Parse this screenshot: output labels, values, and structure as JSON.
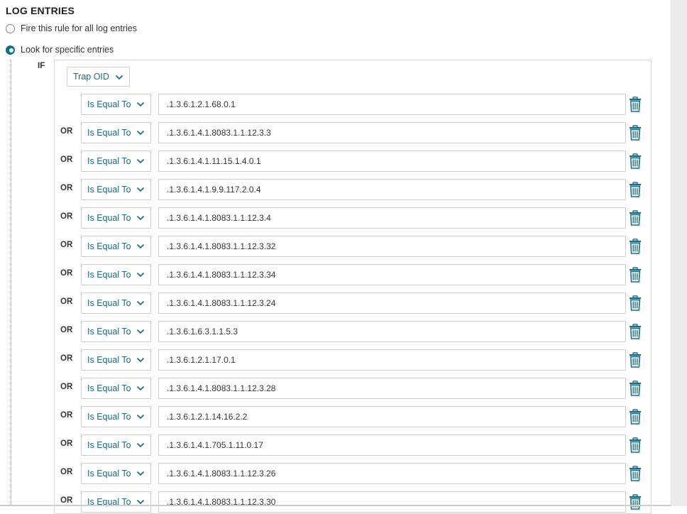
{
  "section": {
    "title": "LOG ENTRIES",
    "options": [
      {
        "label": "Fire this rule for all log entries",
        "selected": false
      },
      {
        "label": "Look for specific entries",
        "selected": true
      }
    ]
  },
  "condition": {
    "if_label": "IF",
    "field_select": "Trap OID",
    "operator_default": "Is Equal To",
    "rows": [
      {
        "connector": "",
        "operator": "Is Equal To",
        "value": ".1.3.6.1.2.1.68.0.1"
      },
      {
        "connector": "OR",
        "operator": "Is Equal To",
        "value": ".1.3.6.1.4.1.8083.1.1.12.3.3"
      },
      {
        "connector": "OR",
        "operator": "Is Equal To",
        "value": ".1.3.6.1.4.1.11.15.1.4.0.1"
      },
      {
        "connector": "OR",
        "operator": "Is Equal To",
        "value": ".1.3.6.1.4.1.9.9.117.2.0.4"
      },
      {
        "connector": "OR",
        "operator": "Is Equal To",
        "value": ".1.3.6.1.4.1.8083.1.1.12.3.4"
      },
      {
        "connector": "OR",
        "operator": "Is Equal To",
        "value": ".1.3.6.1.4.1.8083.1.1.12.3.32"
      },
      {
        "connector": "OR",
        "operator": "Is Equal To",
        "value": ".1.3.6.1.4.1.8083.1.1.12.3.34"
      },
      {
        "connector": "OR",
        "operator": "Is Equal To",
        "value": ".1.3.6.1.4.1.8083.1.1.12.3.24"
      },
      {
        "connector": "OR",
        "operator": "Is Equal To",
        "value": ".1.3.6.1.6.3.1.1.5.3"
      },
      {
        "connector": "OR",
        "operator": "Is Equal To",
        "value": ".1.3.6.1.2.1.17.0.1"
      },
      {
        "connector": "OR",
        "operator": "Is Equal To",
        "value": ".1.3.6.1.4.1.8083.1.1.12.3.28"
      },
      {
        "connector": "OR",
        "operator": "Is Equal To",
        "value": ".1.3.6.1.2.1.14.16.2.2"
      },
      {
        "connector": "OR",
        "operator": "Is Equal To",
        "value": ".1.3.6.1.4.1.705.1.11.0.17"
      },
      {
        "connector": "OR",
        "operator": "Is Equal To",
        "value": ".1.3.6.1.4.1.8083.1.1.12.3.26"
      },
      {
        "connector": "OR",
        "operator": "Is Equal To",
        "value": ".1.3.6.1.4.1.8083.1.1.12.3.30"
      }
    ]
  },
  "icons": {
    "delete": "trash-icon",
    "dropdown": "chevron-down-icon"
  },
  "colors": {
    "accent": "#1d6f86",
    "radio_selected": "#0f6f85"
  }
}
